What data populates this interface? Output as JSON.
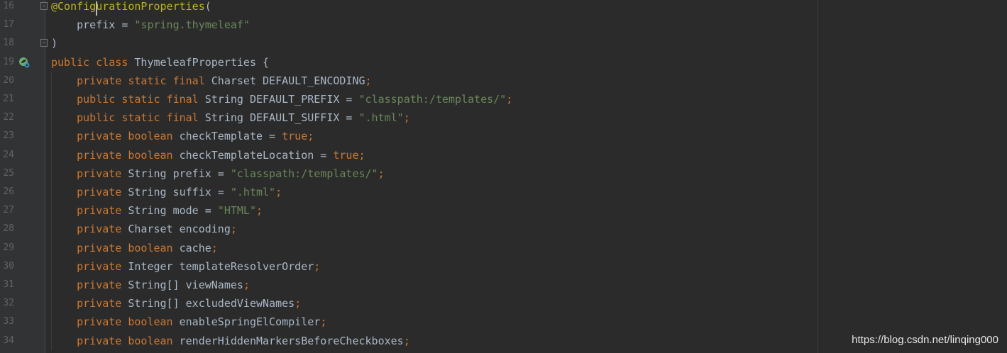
{
  "editor": {
    "lines": [
      {
        "number": "16",
        "tokens": [
          {
            "text": "@ConfigurationProperties",
            "type": "ann"
          },
          {
            "text": "(",
            "type": "plain"
          }
        ]
      },
      {
        "number": "17",
        "tokens": [
          {
            "text": "    prefix = ",
            "type": "plain"
          },
          {
            "text": "\"spring.thymeleaf\"",
            "type": "str"
          }
        ]
      },
      {
        "number": "18",
        "tokens": [
          {
            "text": ")",
            "type": "plain"
          }
        ]
      },
      {
        "number": "19",
        "tokens": [
          {
            "text": "public class ",
            "type": "kw"
          },
          {
            "text": "ThymeleafProperties {",
            "type": "plain"
          }
        ]
      },
      {
        "number": "20",
        "tokens": [
          {
            "text": "    private static final ",
            "type": "kw"
          },
          {
            "text": "Charset DEFAULT_ENCODING",
            "type": "plain"
          },
          {
            "text": ";",
            "type": "kw"
          }
        ]
      },
      {
        "number": "21",
        "tokens": [
          {
            "text": "    public static final ",
            "type": "kw"
          },
          {
            "text": "String DEFAULT_PREFIX = ",
            "type": "plain"
          },
          {
            "text": "\"classpath:/templates/\"",
            "type": "str"
          },
          {
            "text": ";",
            "type": "kw"
          }
        ]
      },
      {
        "number": "22",
        "tokens": [
          {
            "text": "    public static final ",
            "type": "kw"
          },
          {
            "text": "String DEFAULT_SUFFIX = ",
            "type": "plain"
          },
          {
            "text": "\".html\"",
            "type": "str"
          },
          {
            "text": ";",
            "type": "kw"
          }
        ]
      },
      {
        "number": "23",
        "tokens": [
          {
            "text": "    private boolean ",
            "type": "kw"
          },
          {
            "text": "checkTemplate = ",
            "type": "plain"
          },
          {
            "text": "true;",
            "type": "kw"
          }
        ]
      },
      {
        "number": "24",
        "tokens": [
          {
            "text": "    private boolean ",
            "type": "kw"
          },
          {
            "text": "checkTemplateLocation = ",
            "type": "plain"
          },
          {
            "text": "true;",
            "type": "kw"
          }
        ]
      },
      {
        "number": "25",
        "tokens": [
          {
            "text": "    private ",
            "type": "kw"
          },
          {
            "text": "String prefix = ",
            "type": "plain"
          },
          {
            "text": "\"classpath:/templates/\"",
            "type": "str"
          },
          {
            "text": ";",
            "type": "kw"
          }
        ]
      },
      {
        "number": "26",
        "tokens": [
          {
            "text": "    private ",
            "type": "kw"
          },
          {
            "text": "String suffix = ",
            "type": "plain"
          },
          {
            "text": "\".html\"",
            "type": "str"
          },
          {
            "text": ";",
            "type": "kw"
          }
        ]
      },
      {
        "number": "27",
        "tokens": [
          {
            "text": "    private ",
            "type": "kw"
          },
          {
            "text": "String mode = ",
            "type": "plain"
          },
          {
            "text": "\"HTML\"",
            "type": "str"
          },
          {
            "text": ";",
            "type": "kw"
          }
        ]
      },
      {
        "number": "28",
        "tokens": [
          {
            "text": "    private ",
            "type": "kw"
          },
          {
            "text": "Charset encoding",
            "type": "plain"
          },
          {
            "text": ";",
            "type": "kw"
          }
        ]
      },
      {
        "number": "29",
        "tokens": [
          {
            "text": "    private boolean ",
            "type": "kw"
          },
          {
            "text": "cache",
            "type": "plain"
          },
          {
            "text": ";",
            "type": "kw"
          }
        ]
      },
      {
        "number": "30",
        "tokens": [
          {
            "text": "    private ",
            "type": "kw"
          },
          {
            "text": "Integer templateResolverOrder",
            "type": "plain"
          },
          {
            "text": ";",
            "type": "kw"
          }
        ]
      },
      {
        "number": "31",
        "tokens": [
          {
            "text": "    private ",
            "type": "kw"
          },
          {
            "text": "String[] viewNames",
            "type": "plain"
          },
          {
            "text": ";",
            "type": "kw"
          }
        ]
      },
      {
        "number": "32",
        "tokens": [
          {
            "text": "    private ",
            "type": "kw"
          },
          {
            "text": "String[] excludedViewNames",
            "type": "plain"
          },
          {
            "text": ";",
            "type": "kw"
          }
        ]
      },
      {
        "number": "33",
        "tokens": [
          {
            "text": "    private boolean ",
            "type": "kw"
          },
          {
            "text": "enableSpringElCompiler",
            "type": "plain"
          },
          {
            "text": ";",
            "type": "kw"
          }
        ]
      },
      {
        "number": "34",
        "tokens": [
          {
            "text": "    private boolean ",
            "type": "kw"
          },
          {
            "text": "renderHiddenMarkersBeforeCheckboxes",
            "type": "plain"
          },
          {
            "text": ";",
            "type": "kw"
          }
        ]
      }
    ]
  },
  "watermark": "https://blog.csdn.net/linqing000",
  "colors": {
    "background": "#2b2b2b",
    "gutter": "#313335",
    "keyword": "#cc7832",
    "string": "#6a8759",
    "annotation": "#bbb529",
    "plain": "#a9b7c6",
    "line_number": "#606366"
  }
}
